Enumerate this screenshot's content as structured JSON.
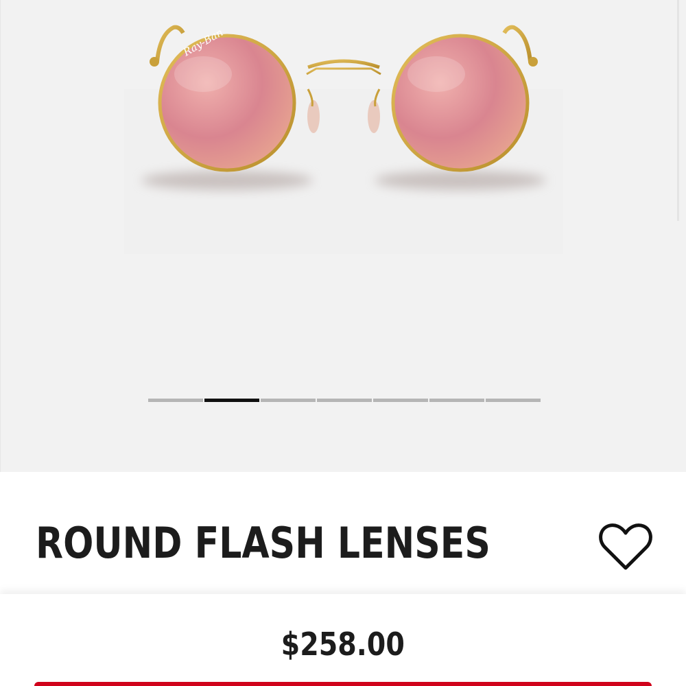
{
  "product": {
    "title": "ROUND FLASH LENSES",
    "price": "$258.00",
    "image_alt": "Gold round sunglasses with pink flash lenses",
    "logo_text": "Ray-Ban"
  },
  "gallery": {
    "slide_count": 7,
    "active_slide": 1
  },
  "icons": {
    "wishlist": "heart-outline-icon"
  },
  "colors": {
    "gallery_background": "#f2f2f2",
    "title_text": "#1c1c1c",
    "indicator_active": "#111111",
    "indicator_inactive": "#b5b5b5",
    "lens": "#d98a92",
    "frame": "#c9a03a",
    "cta": "#d0021b"
  }
}
